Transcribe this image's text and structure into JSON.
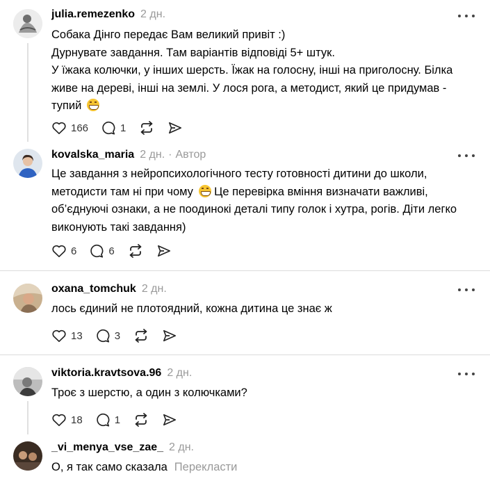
{
  "comments": [
    {
      "username": "julia.remezenko",
      "time": "2 дн.",
      "lines": [
        "Собака Дінго передає Вам великий привіт :)",
        "Дурнувате завдання. Там варіантів відповіді 5+ штук.",
        "У їжака колючки, у інших шерсть. Їжак на голосну, інші на приголосну. Білка",
        "живе на дереві, інші на землі. У лося рога, а методист, який це придумав -",
        "тупий"
      ],
      "likes": "166",
      "replies": "1"
    },
    {
      "username": "kovalska_maria",
      "time": "2 дн.",
      "author_badge": "Автор",
      "lines": [
        "Це завдання з нейропсихологічного тесту готовності дитини до школи,",
        "методисти там ні при чому",
        "Це перевірка вміння визначати важливі,",
        "об’єднуючі ознаки, а не поодинокі деталі типу голок і хутра, рогів. Діти легко",
        "виконують такі завдання)"
      ],
      "likes": "6",
      "replies": "6"
    },
    {
      "username": "oxana_tomchuk",
      "time": "2 дн.",
      "lines": [
        "лось єдиний не плотоядний, кожна дитина це знає ж"
      ],
      "likes": "13",
      "replies": "3"
    },
    {
      "username": "viktoria.kravtsova.96",
      "time": "2 дн.",
      "lines": [
        "Троє з шерстю, а один з колючками?"
      ],
      "likes": "18",
      "replies": "1"
    },
    {
      "username": "_vi_menya_vse_zae_",
      "time": "2 дн.",
      "lines": [
        "О, я так само сказала"
      ],
      "translate": "Перекласти"
    }
  ],
  "icons": {
    "like": "heart-icon",
    "reply": "comment-icon",
    "repost": "repost-icon",
    "share": "share-icon",
    "more": "more-icon"
  }
}
